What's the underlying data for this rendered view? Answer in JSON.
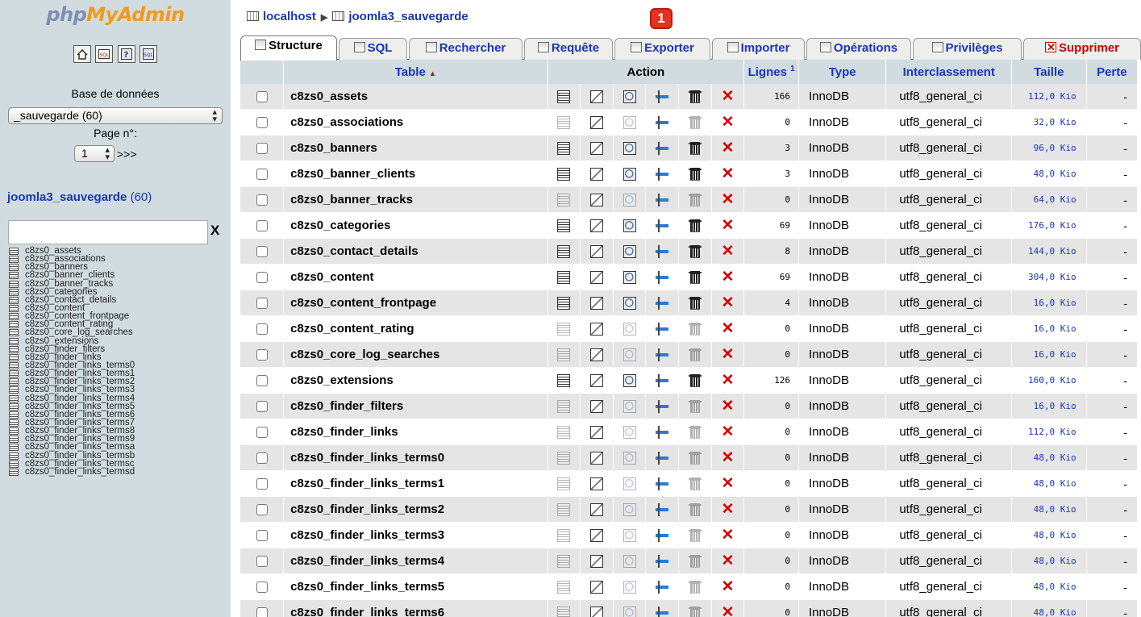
{
  "left": {
    "logo": {
      "part1": "php",
      "part2": "MyAdmin"
    },
    "icons": [
      "home-icon",
      "sql-icon",
      "help-icon",
      "sql-doc-icon"
    ],
    "db_label": "Base de données",
    "db_select": "_sauvegarde (60)",
    "page_label": "Page n°:",
    "page_value": "1",
    "page_next": ">>>",
    "db_link_name": "joomla3_sauvegarde",
    "db_link_count": "(60)",
    "filter_clear": "X",
    "tables": [
      "c8zs0_assets",
      "c8zs0_associations",
      "c8zs0_banners",
      "c8zs0_banner_clients",
      "c8zs0_banner_tracks",
      "c8zs0_categories",
      "c8zs0_contact_details",
      "c8zs0_content",
      "c8zs0_content_frontpage",
      "c8zs0_content_rating",
      "c8zs0_core_log_searches",
      "c8zs0_extensions",
      "c8zs0_finder_filters",
      "c8zs0_finder_links",
      "c8zs0_finder_links_terms0",
      "c8zs0_finder_links_terms1",
      "c8zs0_finder_links_terms2",
      "c8zs0_finder_links_terms3",
      "c8zs0_finder_links_terms4",
      "c8zs0_finder_links_terms5",
      "c8zs0_finder_links_terms6",
      "c8zs0_finder_links_terms7",
      "c8zs0_finder_links_terms8",
      "c8zs0_finder_links_terms9",
      "c8zs0_finder_links_termsa",
      "c8zs0_finder_links_termsb",
      "c8zs0_finder_links_termsc",
      "c8zs0_finder_links_termsd"
    ]
  },
  "breadcrumb": {
    "server": "localhost",
    "sep": "▶",
    "database": "joomla3_sauvegarde"
  },
  "badge": "1",
  "tabs": [
    {
      "label": "Structure",
      "icon": "structure-icon",
      "active": true
    },
    {
      "label": "SQL",
      "icon": "sql-icon"
    },
    {
      "label": "Rechercher",
      "icon": "search-icon"
    },
    {
      "label": "Requête",
      "icon": "query-icon"
    },
    {
      "label": "Exporter",
      "icon": "export-icon"
    },
    {
      "label": "Importer",
      "icon": "import-icon"
    },
    {
      "label": "Opérations",
      "icon": "operations-icon"
    },
    {
      "label": "Privilèges",
      "icon": "privileges-icon"
    },
    {
      "label": "Supprimer",
      "icon": "drop-icon",
      "danger": true
    }
  ],
  "table": {
    "headers": {
      "table": "Table",
      "sort_arrow": "▲",
      "action": "Action",
      "rows": "Lignes",
      "rows_sup": "1",
      "type": "Type",
      "collation": "Interclassement",
      "size": "Taille",
      "overhead": "Perte"
    },
    "rows": [
      {
        "name": "c8zs0_assets",
        "rows": "166",
        "type": "InnoDB",
        "collation": "utf8_general_ci",
        "size": "112,0 Kio",
        "overhead": "-",
        "empty": false
      },
      {
        "name": "c8zs0_associations",
        "rows": "0",
        "type": "InnoDB",
        "collation": "utf8_general_ci",
        "size": "32,0 Kio",
        "overhead": "-",
        "empty": true
      },
      {
        "name": "c8zs0_banners",
        "rows": "3",
        "type": "InnoDB",
        "collation": "utf8_general_ci",
        "size": "96,0 Kio",
        "overhead": "-",
        "empty": false
      },
      {
        "name": "c8zs0_banner_clients",
        "rows": "3",
        "type": "InnoDB",
        "collation": "utf8_general_ci",
        "size": "48,0 Kio",
        "overhead": "-",
        "empty": false
      },
      {
        "name": "c8zs0_banner_tracks",
        "rows": "0",
        "type": "InnoDB",
        "collation": "utf8_general_ci",
        "size": "64,0 Kio",
        "overhead": "-",
        "empty": true
      },
      {
        "name": "c8zs0_categories",
        "rows": "69",
        "type": "InnoDB",
        "collation": "utf8_general_ci",
        "size": "176,0 Kio",
        "overhead": "-",
        "empty": false
      },
      {
        "name": "c8zs0_contact_details",
        "rows": "8",
        "type": "InnoDB",
        "collation": "utf8_general_ci",
        "size": "144,0 Kio",
        "overhead": "-",
        "empty": false
      },
      {
        "name": "c8zs0_content",
        "rows": "69",
        "type": "InnoDB",
        "collation": "utf8_general_ci",
        "size": "304,0 Kio",
        "overhead": "-",
        "empty": false
      },
      {
        "name": "c8zs0_content_frontpage",
        "rows": "4",
        "type": "InnoDB",
        "collation": "utf8_general_ci",
        "size": "16,0 Kio",
        "overhead": "-",
        "empty": false
      },
      {
        "name": "c8zs0_content_rating",
        "rows": "0",
        "type": "InnoDB",
        "collation": "utf8_general_ci",
        "size": "16,0 Kio",
        "overhead": "-",
        "empty": true
      },
      {
        "name": "c8zs0_core_log_searches",
        "rows": "0",
        "type": "InnoDB",
        "collation": "utf8_general_ci",
        "size": "16,0 Kio",
        "overhead": "-",
        "empty": true
      },
      {
        "name": "c8zs0_extensions",
        "rows": "126",
        "type": "InnoDB",
        "collation": "utf8_general_ci",
        "size": "160,0 Kio",
        "overhead": "-",
        "empty": false
      },
      {
        "name": "c8zs0_finder_filters",
        "rows": "0",
        "type": "InnoDB",
        "collation": "utf8_general_ci",
        "size": "16,0 Kio",
        "overhead": "-",
        "empty": true
      },
      {
        "name": "c8zs0_finder_links",
        "rows": "0",
        "type": "InnoDB",
        "collation": "utf8_general_ci",
        "size": "112,0 Kio",
        "overhead": "-",
        "empty": true
      },
      {
        "name": "c8zs0_finder_links_terms0",
        "rows": "0",
        "type": "InnoDB",
        "collation": "utf8_general_ci",
        "size": "48,0 Kio",
        "overhead": "-",
        "empty": true
      },
      {
        "name": "c8zs0_finder_links_terms1",
        "rows": "0",
        "type": "InnoDB",
        "collation": "utf8_general_ci",
        "size": "48,0 Kio",
        "overhead": "-",
        "empty": true
      },
      {
        "name": "c8zs0_finder_links_terms2",
        "rows": "0",
        "type": "InnoDB",
        "collation": "utf8_general_ci",
        "size": "48,0 Kio",
        "overhead": "-",
        "empty": true
      },
      {
        "name": "c8zs0_finder_links_terms3",
        "rows": "0",
        "type": "InnoDB",
        "collation": "utf8_general_ci",
        "size": "48,0 Kio",
        "overhead": "-",
        "empty": true
      },
      {
        "name": "c8zs0_finder_links_terms4",
        "rows": "0",
        "type": "InnoDB",
        "collation": "utf8_general_ci",
        "size": "48,0 Kio",
        "overhead": "-",
        "empty": true
      },
      {
        "name": "c8zs0_finder_links_terms5",
        "rows": "0",
        "type": "InnoDB",
        "collation": "utf8_general_ci",
        "size": "48,0 Kio",
        "overhead": "-",
        "empty": true
      },
      {
        "name": "c8zs0_finder_links_terms6",
        "rows": "0",
        "type": "InnoDB",
        "collation": "utf8_general_ci",
        "size": "48,0 Kio",
        "overhead": "-",
        "empty": true
      }
    ]
  },
  "colors": {
    "sidebar_bg": "#d0dce0",
    "link": "#1a36b0",
    "drop": "#d40000",
    "badge": "#e63020",
    "row_alt": "#e5e5e5"
  }
}
